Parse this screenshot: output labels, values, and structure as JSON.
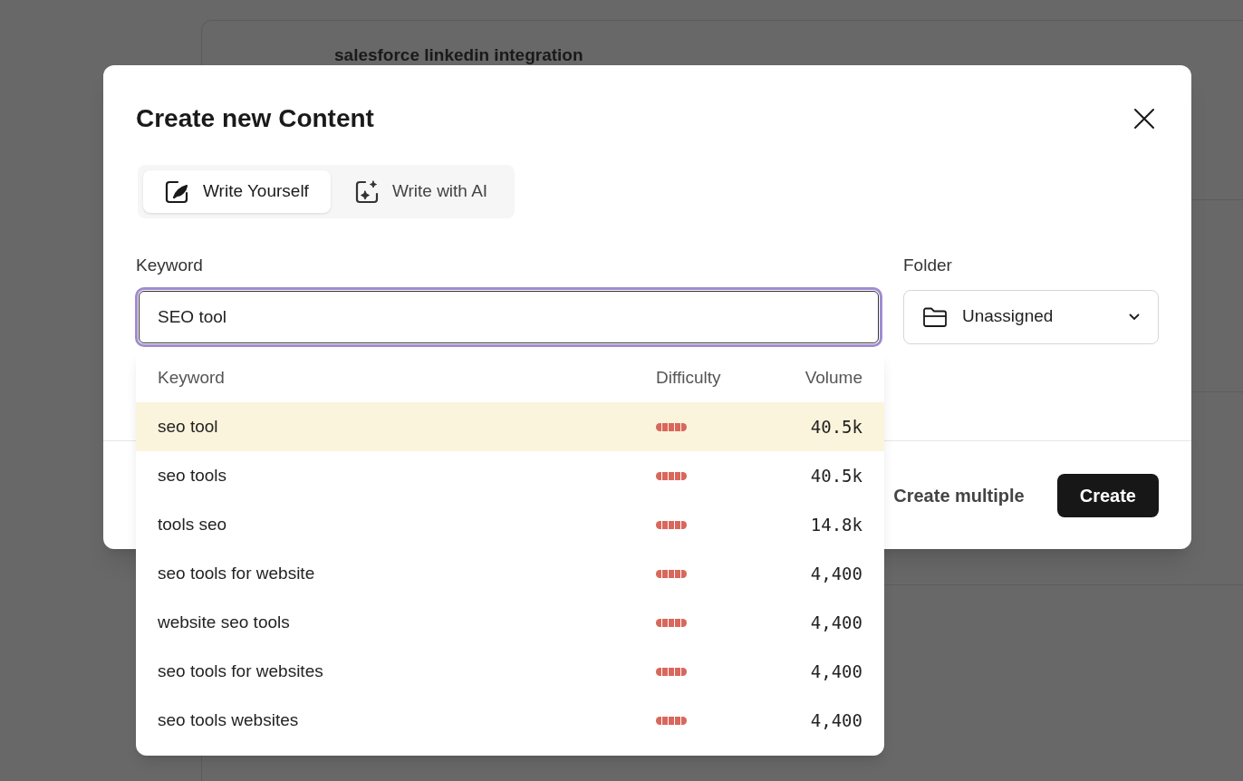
{
  "background": {
    "card_title": "salesforce linkedin integration"
  },
  "dialog": {
    "title": "Create new Content",
    "tabs": [
      {
        "label": "Write Yourself",
        "kind": "write",
        "selected": true
      },
      {
        "label": "Write with AI",
        "kind": "ai",
        "selected": false
      }
    ],
    "keyword": {
      "label": "Keyword",
      "value": "SEO tool"
    },
    "folder": {
      "label": "Folder",
      "value": "Unassigned"
    },
    "buttons": [
      {
        "label": "Create multiple",
        "kind": "secondary"
      },
      {
        "label": "Create",
        "kind": "primary"
      }
    ]
  },
  "suggestions": {
    "columns": [
      "Keyword",
      "Difficulty",
      "Volume"
    ],
    "rows": [
      {
        "keyword": "seo tool",
        "level": 1,
        "volume": "40.5k",
        "selected": true
      },
      {
        "keyword": "seo tools",
        "level": 1,
        "volume": "40.5k",
        "selected": false
      },
      {
        "keyword": "tools seo",
        "level": 1,
        "volume": "14.8k",
        "selected": false
      },
      {
        "keyword": "seo tools for website",
        "level": 1,
        "volume": "4,400",
        "selected": false
      },
      {
        "keyword": "website seo tools",
        "level": 1,
        "volume": "4,400",
        "selected": false
      },
      {
        "keyword": "seo tools for websites",
        "level": 1,
        "volume": "4,400",
        "selected": false
      },
      {
        "keyword": "seo tools websites",
        "level": 1,
        "volume": "4,400",
        "selected": false
      }
    ]
  }
}
